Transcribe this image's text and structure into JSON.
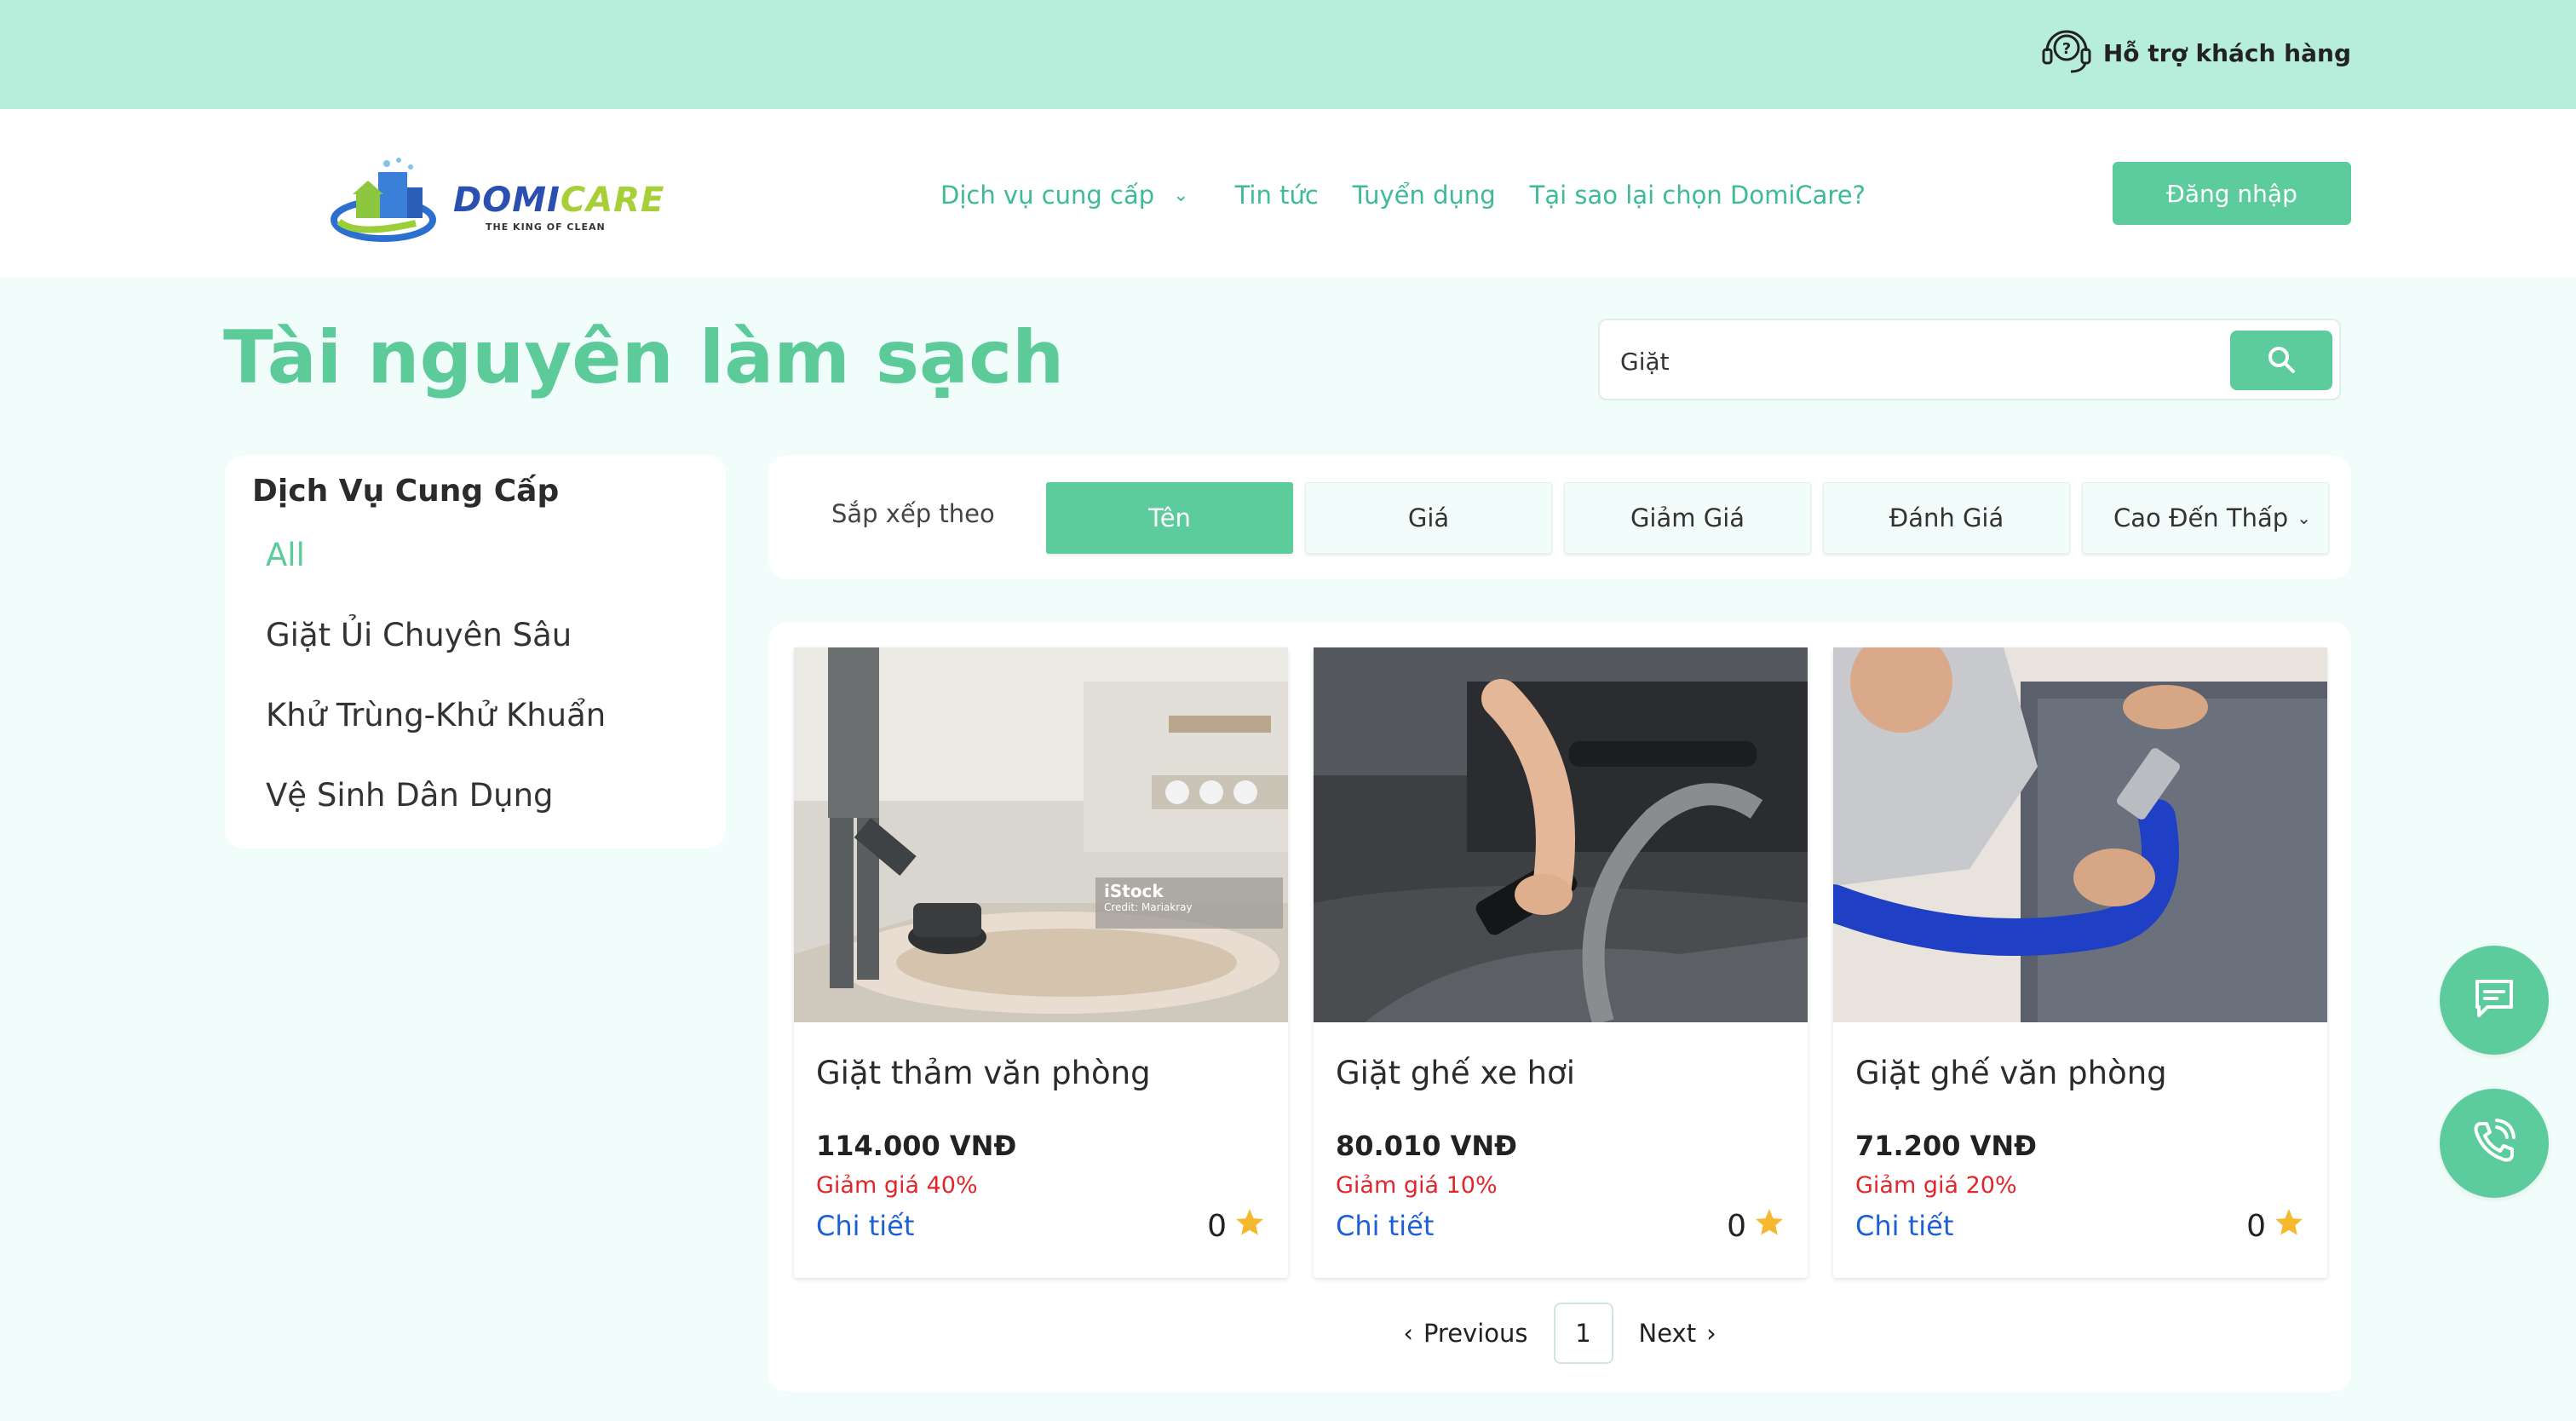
{
  "topbar": {
    "support_label": "Hỗ trợ khách hàng"
  },
  "header": {
    "logo_text_a": "DOMI",
    "logo_text_b": "CARE",
    "logo_tagline": "THE KING OF CLEAN",
    "nav": [
      {
        "label": "Dịch vụ cung cấp"
      },
      {
        "label": "Tin tức"
      },
      {
        "label": "Tuyển dụng"
      },
      {
        "label": "Tại sao lại chọn DomiCare?"
      }
    ],
    "login_label": "Đăng nhập"
  },
  "page": {
    "title": "Tài nguyên làm sạch"
  },
  "search": {
    "value": "Giặt"
  },
  "sidebar": {
    "title": "Dịch Vụ Cung Cấp",
    "items": [
      {
        "label": "All"
      },
      {
        "label": "Giặt Ủi Chuyên Sâu"
      },
      {
        "label": "Khử Trùng-Khử Khuẩn"
      },
      {
        "label": "Vệ Sinh Dân Dụng"
      }
    ]
  },
  "sort": {
    "label": "Sắp xếp theo",
    "options": [
      "Tên",
      "Giá",
      "Giảm Giá",
      "Đánh Giá"
    ],
    "order_selected": "Cao Đến Thấp"
  },
  "products": [
    {
      "name": "Giặt thảm văn phòng",
      "price": "114.000 VNĐ",
      "discount": "Giảm giá 40%",
      "detail": "Chi tiết",
      "rating": "0",
      "image_watermark": "iStock",
      "image_credit": "Credit: Mariakray"
    },
    {
      "name": "Giặt ghế xe hơi",
      "price": "80.010 VNĐ",
      "discount": "Giảm giá 10%",
      "detail": "Chi tiết",
      "rating": "0"
    },
    {
      "name": "Giặt ghế văn phòng",
      "price": "71.200 VNĐ",
      "discount": "Giảm giá 20%",
      "detail": "Chi tiết",
      "rating": "0"
    }
  ],
  "pagination": {
    "previous": "Previous",
    "current": "1",
    "next": "Next"
  },
  "colors": {
    "accent": "#5dcc9c",
    "topbar": "#b6eedb",
    "discount": "#e0262a",
    "link": "#1d5fd6",
    "star": "#f5b82e"
  },
  "icons": {
    "support": "headset-question-icon",
    "search": "search-icon",
    "chat": "chat-icon",
    "phone": "phone-icon",
    "star": "star-icon"
  }
}
